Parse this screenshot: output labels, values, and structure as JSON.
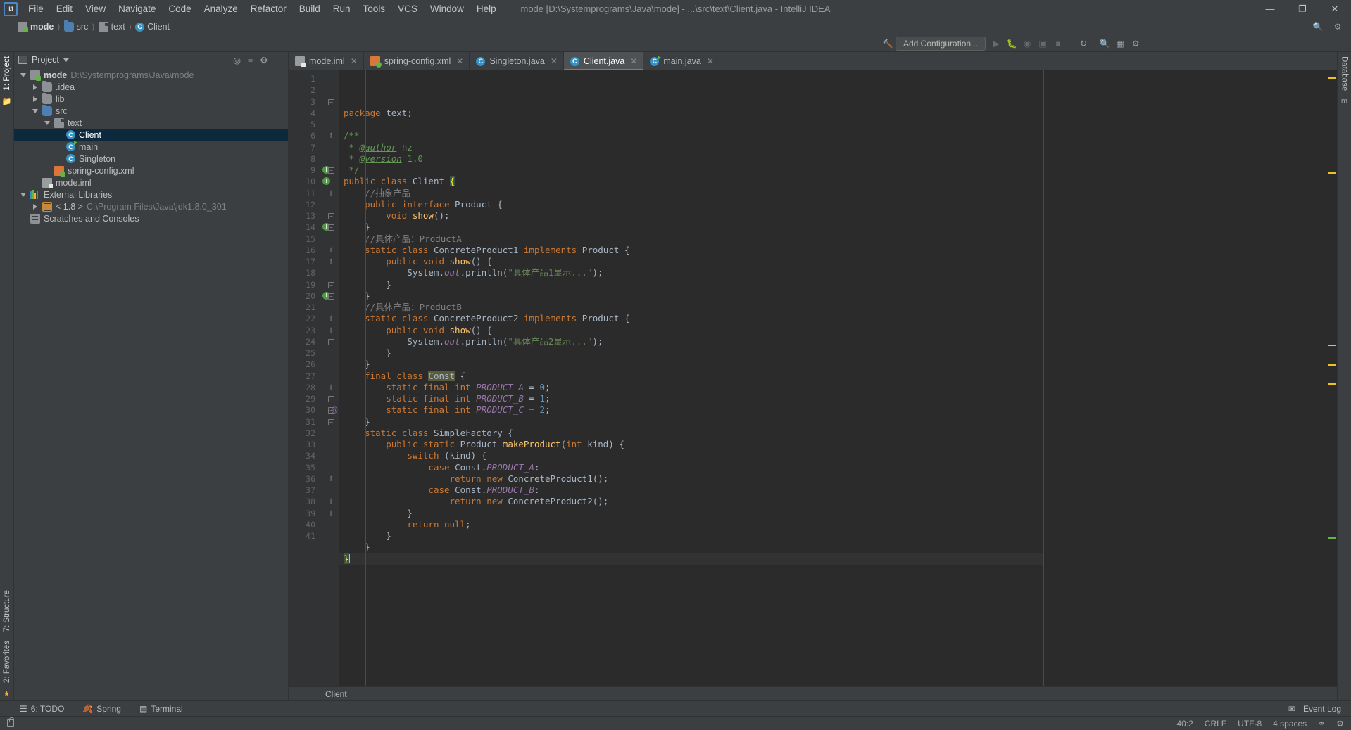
{
  "window": {
    "title": "mode [D:\\Systemprograms\\Java\\mode] - ...\\src\\text\\Client.java - IntelliJ IDEA",
    "logo": "IJ",
    "minimize": "—",
    "maximize": "❐",
    "close": "✕"
  },
  "menubar": [
    {
      "label": "File"
    },
    {
      "label": "Edit"
    },
    {
      "label": "View"
    },
    {
      "label": "Navigate"
    },
    {
      "label": "Code"
    },
    {
      "label": "Analyze"
    },
    {
      "label": "Refactor"
    },
    {
      "label": "Build"
    },
    {
      "label": "Run"
    },
    {
      "label": "Tools"
    },
    {
      "label": "VCS"
    },
    {
      "label": "Window"
    },
    {
      "label": "Help"
    }
  ],
  "breadcrumb": [
    {
      "label": "mode",
      "icon": "module-icon"
    },
    {
      "label": "src",
      "icon": "folder-icon"
    },
    {
      "label": "text",
      "icon": "package-icon"
    },
    {
      "label": "Client",
      "icon": "class-icon"
    }
  ],
  "toolbar": {
    "add_configuration": "Add Configuration...",
    "icons": [
      "build-icon",
      "run-icon",
      "debug-icon",
      "run-coverage-icon",
      "profile-icon",
      "stop-icon",
      "search-everywhere-icon",
      "project-structure-icon",
      "settings-icon"
    ]
  },
  "left_rail": {
    "project_label": "1: Project",
    "structure_label": "7: Structure",
    "favorites_label": "2: Favorites"
  },
  "right_rail": {
    "database_label": "Database",
    "maven_label": "Maven"
  },
  "project_panel": {
    "title": "Project",
    "tree": [
      {
        "label": "mode",
        "secondary": "D:\\Systemprograms\\Java\\mode",
        "icon": "module-icon",
        "arrow": "down",
        "indent": 0,
        "bold": true
      },
      {
        "label": ".idea",
        "secondary": "",
        "icon": "folder-icon",
        "arrow": "right",
        "indent": 1
      },
      {
        "label": "lib",
        "secondary": "",
        "icon": "folder-icon",
        "arrow": "right",
        "indent": 1
      },
      {
        "label": "src",
        "secondary": "",
        "icon": "source-folder-icon",
        "arrow": "down",
        "indent": 1
      },
      {
        "label": "text",
        "secondary": "",
        "icon": "package-icon",
        "arrow": "down",
        "indent": 2
      },
      {
        "label": "Client",
        "secondary": "",
        "icon": "class-icon",
        "arrow": "none",
        "indent": 3,
        "selected": true
      },
      {
        "label": "main",
        "secondary": "",
        "icon": "runnable-class-icon",
        "arrow": "none",
        "indent": 3
      },
      {
        "label": "Singleton",
        "secondary": "",
        "icon": "class-icon",
        "arrow": "none",
        "indent": 3
      },
      {
        "label": "spring-config.xml",
        "secondary": "",
        "icon": "spring-xml-icon",
        "arrow": "none",
        "indent": 2
      },
      {
        "label": "mode.iml",
        "secondary": "",
        "icon": "iml-icon",
        "arrow": "none",
        "indent": 1
      },
      {
        "label": "External Libraries",
        "secondary": "",
        "icon": "libraries-icon",
        "arrow": "down",
        "indent": 0
      },
      {
        "label": "< 1.8 >",
        "secondary": "C:\\Program Files\\Java\\jdk1.8.0_301",
        "icon": "jdk-icon",
        "arrow": "right",
        "indent": 1
      },
      {
        "label": "Scratches and Consoles",
        "secondary": "",
        "icon": "scratches-icon",
        "arrow": "none",
        "indent": 0
      }
    ]
  },
  "editor": {
    "tabs": [
      {
        "label": "mode.iml",
        "icon": "iml-icon",
        "active": false
      },
      {
        "label": "spring-config.xml",
        "icon": "spring-xml-icon",
        "active": false
      },
      {
        "label": "Singleton.java",
        "icon": "class-icon",
        "active": false
      },
      {
        "label": "Client.java",
        "icon": "class-icon",
        "active": true
      },
      {
        "label": "main.java",
        "icon": "runnable-class-icon",
        "active": false
      }
    ],
    "breadcrumb_strip": "Client",
    "first_line": 1,
    "last_line": 41,
    "lines": [
      {
        "n": 1,
        "html": "<span class='kw'>package</span> text;"
      },
      {
        "n": 2,
        "html": ""
      },
      {
        "n": 3,
        "html": "<span class='doc'>/**</span>"
      },
      {
        "n": 4,
        "html": " <span class='doc'>*</span> <span class='doctag'>@author</span> <span class='doc'>hz</span>"
      },
      {
        "n": 5,
        "html": " <span class='doc'>*</span> <span class='doctag'>@version</span> <span class='doc'>1.0</span>"
      },
      {
        "n": 6,
        "html": " <span class='doc'>*/</span>"
      },
      {
        "n": 7,
        "html": "<span class='kw'>public class </span>Client <span class='brmatch'>{</span>"
      },
      {
        "n": 8,
        "html": "    <span class='cmt'>//抽象产品</span>"
      },
      {
        "n": 9,
        "html": "    <span class='kw'>public interface </span>Product {"
      },
      {
        "n": 10,
        "html": "        <span class='kw'>void </span><span class='mth'>show</span>();"
      },
      {
        "n": 11,
        "html": "    }"
      },
      {
        "n": 12,
        "html": "    <span class='cmt'>//具体产品：ProductA</span>"
      },
      {
        "n": 13,
        "html": "    <span class='kw'>static class </span>ConcreteProduct1 <span class='kw'>implements </span>Product {"
      },
      {
        "n": 14,
        "html": "        <span class='kw'>public void </span><span class='mth'>show</span>() {"
      },
      {
        "n": 15,
        "html": "            System.<span class='fld'>out</span>.println(<span class='str'>\"具体产品1显示...\"</span>);"
      },
      {
        "n": 16,
        "html": "        }"
      },
      {
        "n": 17,
        "html": "    }"
      },
      {
        "n": 18,
        "html": "    <span class='cmt'>//具体产品：ProductB</span>"
      },
      {
        "n": 19,
        "html": "    <span class='kw'>static class </span>ConcreteProduct2 <span class='kw'>implements </span>Product {"
      },
      {
        "n": 20,
        "html": "        <span class='kw'>public void </span><span class='mth'>show</span>() {"
      },
      {
        "n": 21,
        "html": "            System.<span class='fld'>out</span>.println(<span class='str'>\"具体产品2显示...\"</span>);"
      },
      {
        "n": 22,
        "html": "        }"
      },
      {
        "n": 23,
        "html": "    }"
      },
      {
        "n": 24,
        "html": "    <span class='kw'>final class </span><span class='hl'>Const</span> {"
      },
      {
        "n": 25,
        "html": "        <span class='kw'>static final int </span><span class='stat'>PRODUCT_A </span>= <span class='num'>0</span>;"
      },
      {
        "n": 26,
        "html": "        <span class='kw'>static final int </span><span class='stat'>PRODUCT_B </span>= <span class='num'>1</span>;"
      },
      {
        "n": 27,
        "html": "        <span class='kw'>static final int </span><span class='stat'>PRODUCT_C </span>= <span class='num'>2</span>;"
      },
      {
        "n": 28,
        "html": "    }"
      },
      {
        "n": 29,
        "html": "    <span class='kw'>static class </span>SimpleFactory {"
      },
      {
        "n": 30,
        "html": "        <span class='kw'>public static </span>Product <span class='mth'>makeProduct</span>(<span class='kw'>int </span>kind) {"
      },
      {
        "n": 31,
        "html": "            <span class='kw'>switch </span>(kind) {"
      },
      {
        "n": 32,
        "html": "                <span class='kw'>case </span>Const.<span class='stat'>PRODUCT_A</span>:"
      },
      {
        "n": 33,
        "html": "                    <span class='kw'>return new </span>ConcreteProduct1();"
      },
      {
        "n": 34,
        "html": "                <span class='kw'>case </span>Const.<span class='stat'>PRODUCT_B</span>:"
      },
      {
        "n": 35,
        "html": "                    <span class='kw'>return new </span>ConcreteProduct2();"
      },
      {
        "n": 36,
        "html": "            }"
      },
      {
        "n": 37,
        "html": "            <span class='kw'>return null</span>;"
      },
      {
        "n": 38,
        "html": "        }"
      },
      {
        "n": 39,
        "html": "    }"
      },
      {
        "n": 40,
        "html": "<span class='brmatch'>}</span><span class='caret'></span>",
        "current": true
      },
      {
        "n": 41,
        "html": ""
      }
    ]
  },
  "bottom_tools": [
    {
      "label": "6: TODO",
      "icon": "todo-icon"
    },
    {
      "label": "Spring",
      "icon": "spring-icon"
    },
    {
      "label": "Terminal",
      "icon": "terminal-icon"
    }
  ],
  "bottom_right": {
    "event_log": "Event Log"
  },
  "statusbar": {
    "caret_position": "40:2",
    "line_separator": "CRLF",
    "encoding": "UTF-8",
    "indent": "4 spaces",
    "lock_icon": "lock-icon",
    "branch_icon": "git-branch-icon"
  },
  "colors": {
    "accent": "#4a88c7",
    "selection": "#0d293e",
    "panel_bg": "#3c3f41",
    "editor_bg": "#2b2b2b",
    "gutter_bg": "#313335",
    "keyword": "#cc7832",
    "string": "#6a8759",
    "comment": "#808080",
    "number": "#6897bb",
    "field": "#9876aa",
    "method": "#ffc66d"
  }
}
